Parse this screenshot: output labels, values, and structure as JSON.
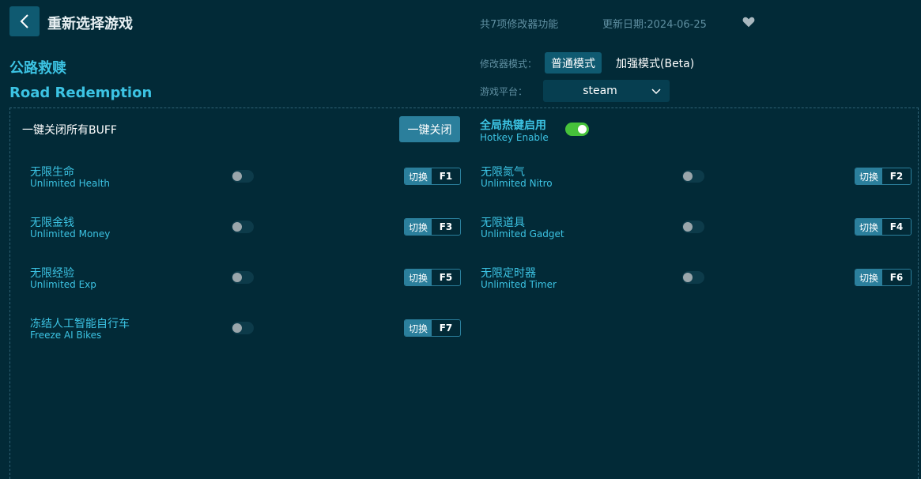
{
  "header": {
    "title": "重新选择游戏",
    "feature_count": "共7项修改器功能",
    "update_date": "更新日期:2024-06-25"
  },
  "game": {
    "name_cn": "公路救赎",
    "name_en": "Road Redemption"
  },
  "mode": {
    "label": "修改器模式：",
    "normal": "普通模式",
    "enhanced": "加强模式(Beta)",
    "selected": "普通模式"
  },
  "platform": {
    "label": "游戏平台：",
    "value": "steam"
  },
  "buff": {
    "label": "一键关闭所有BUFF",
    "button": "一键关闭"
  },
  "hotkey": {
    "label_cn": "全局热键启用",
    "label_en": "Hotkey Enable",
    "enabled": true
  },
  "options": [
    {
      "cn": "无限生命",
      "en": "Unlimited Health",
      "switch": "切换",
      "key": "F1",
      "on": false
    },
    {
      "cn": "无限氮气",
      "en": "Unlimited Nitro",
      "switch": "切换",
      "key": "F2",
      "on": false
    },
    {
      "cn": "无限金钱",
      "en": "Unlimited Money",
      "switch": "切换",
      "key": "F3",
      "on": false
    },
    {
      "cn": "无限道具",
      "en": "Unlimited Gadget",
      "switch": "切换",
      "key": "F4",
      "on": false
    },
    {
      "cn": "无限经验",
      "en": "Unlimited Exp",
      "switch": "切换",
      "key": "F5",
      "on": false
    },
    {
      "cn": "无限定时器",
      "en": "Unlimited Timer",
      "switch": "切换",
      "key": "F6",
      "on": false
    },
    {
      "cn": "冻结人工智能自行车",
      "en": "Freeze AI Bikes",
      "switch": "切换",
      "key": "F7",
      "on": false
    }
  ],
  "colors": {
    "background": "#022a37",
    "accent": "#3cc3e3",
    "button": "#2b7f9c",
    "toggle_on": "#46c23a"
  },
  "icons": {
    "back": "chevron-left-icon",
    "favorite": "heart-icon",
    "dropdown": "chevron-down-icon"
  }
}
